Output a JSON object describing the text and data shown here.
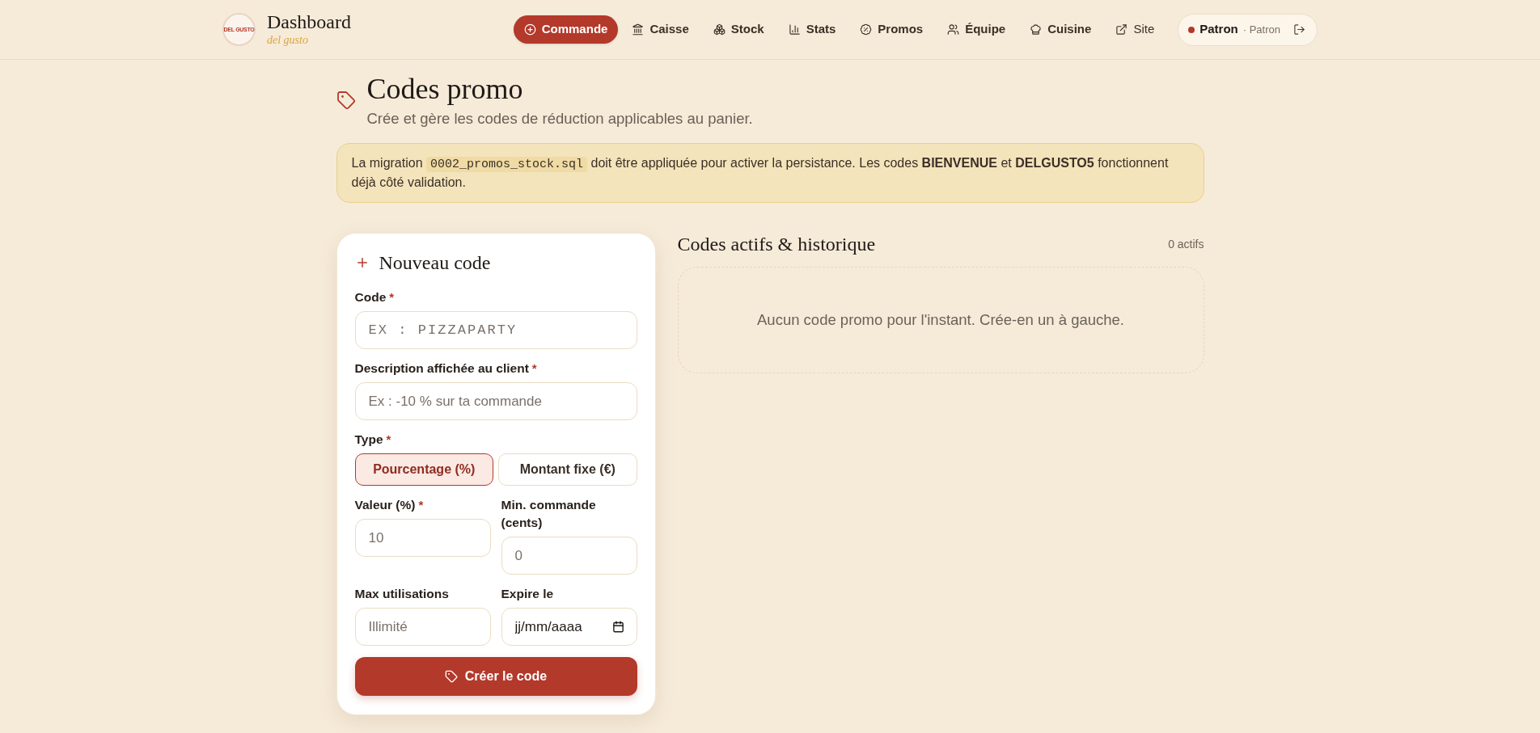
{
  "header": {
    "logo_text": "DEL GUSTO",
    "title": "Dashboard",
    "subtitle": "del gusto",
    "nav": [
      {
        "label": "Commande",
        "kind": "primary"
      },
      {
        "label": "Caisse",
        "kind": "link"
      },
      {
        "label": "Stock",
        "kind": "link"
      },
      {
        "label": "Stats",
        "kind": "link"
      },
      {
        "label": "Promos",
        "kind": "link"
      },
      {
        "label": "Équipe",
        "kind": "link"
      },
      {
        "label": "Cuisine",
        "kind": "link"
      },
      {
        "label": "Site",
        "kind": "external"
      }
    ],
    "user": {
      "name": "Patron",
      "role": "· Patron"
    }
  },
  "page": {
    "title": "Codes promo",
    "subtitle": "Crée et gère les codes de réduction applicables au panier."
  },
  "notice": {
    "parts": [
      {
        "kind": "text",
        "text": "La migration "
      },
      {
        "kind": "code",
        "text": "0002_promos_stock.sql"
      },
      {
        "kind": "text",
        "text": " doit être appliquée pour activer la persistance. Les codes **BIENVENUE** et **DELGUSTO5** fonctionnent déjà côté validation."
      }
    ]
  },
  "form": {
    "title": "Nouveau code",
    "rows": [
      {
        "fields": [
          {
            "kind": "code",
            "label": "Code",
            "required_mark": "*",
            "placeholder": "EX : PIZZAPARTY"
          }
        ]
      },
      {
        "fields": [
          {
            "kind": "text",
            "label": "Description affichée au client",
            "required_mark": "*",
            "placeholder": "Ex : -10 % sur ta commande"
          }
        ]
      },
      {
        "fields": [
          {
            "kind": "choice",
            "label": "Type",
            "required_mark": "*",
            "options": [
              {
                "label": "Pourcentage (%)",
                "selected": true
              },
              {
                "label": "Montant fixe (€)",
                "selected": false
              }
            ]
          }
        ]
      },
      {
        "fields": [
          {
            "kind": "text",
            "label": "Valeur (%)",
            "required_mark": "*",
            "placeholder": "10"
          },
          {
            "kind": "text",
            "label": "Min. commande (cents)",
            "placeholder": "0"
          }
        ]
      },
      {
        "fields": [
          {
            "kind": "text",
            "label": "Max utilisations",
            "placeholder": "Illimité"
          },
          {
            "kind": "date",
            "label": "Expire le",
            "placeholder": "jj/mm/aaaa"
          }
        ]
      }
    ],
    "submit": "Créer le code"
  },
  "list": {
    "title": "Codes actifs & historique",
    "count": "0 actifs",
    "empty": "Aucun code promo pour l'instant. Crée-en un à gauche."
  }
}
